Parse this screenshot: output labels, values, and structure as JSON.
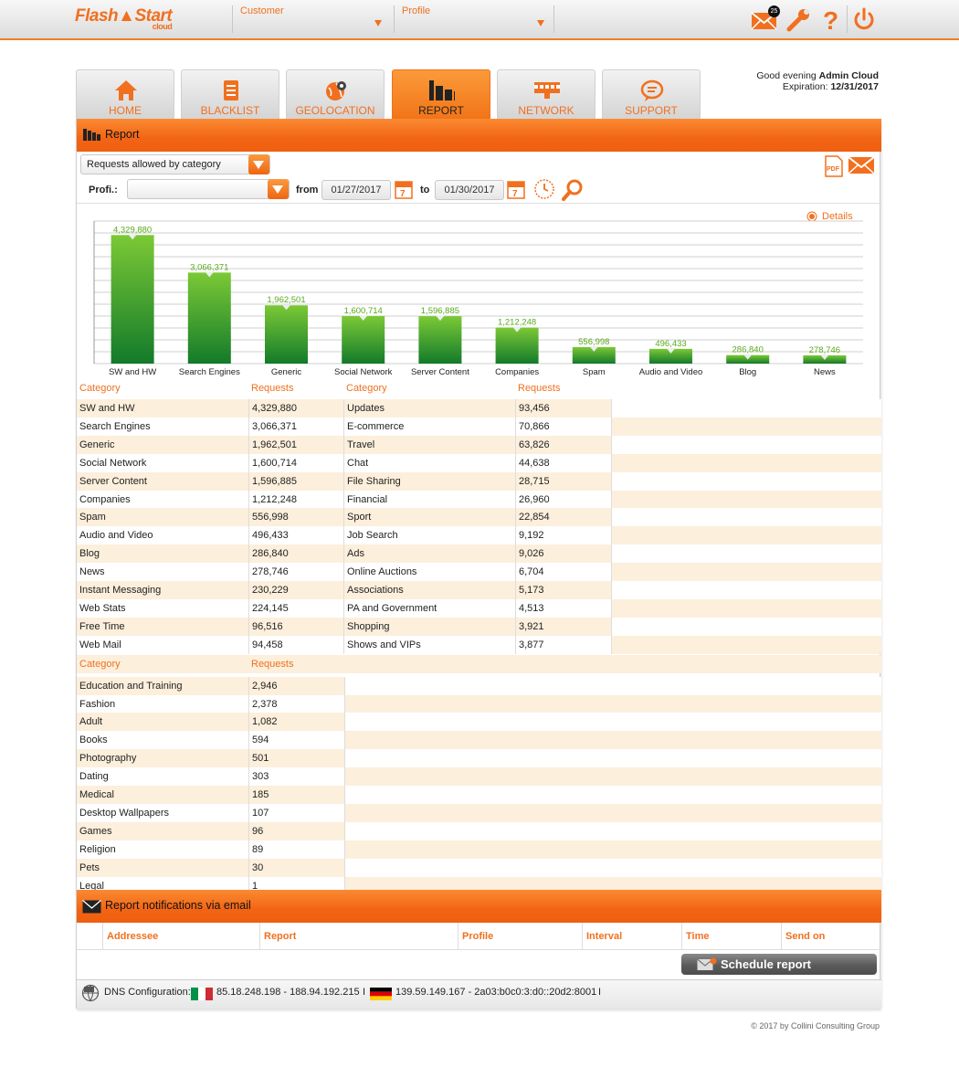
{
  "header": {
    "logo_text": "Flash",
    "logo_text2": "Start",
    "logo_sub": "cloud",
    "customer_label": "Customer",
    "profile_label": "Profile",
    "mail_badge": "25"
  },
  "greeting": {
    "prefix": "Good evening",
    "user": "Admin Cloud",
    "expiration_label": "Expiration:",
    "expiration_value": "12/31/2017"
  },
  "tabs": [
    {
      "label": "HOME",
      "icon": "home-icon"
    },
    {
      "label": "BLACKLIST",
      "icon": "list-icon"
    },
    {
      "label": "GEOLOCATION",
      "icon": "globe-pin-icon"
    },
    {
      "label": "REPORT",
      "icon": "bar-chart-icon",
      "active": true
    },
    {
      "label": "NETWORK",
      "icon": "network-icon"
    },
    {
      "label": "SUPPORT",
      "icon": "chat-bubble-icon"
    }
  ],
  "report": {
    "title": "Report",
    "report_type": "Requests allowed by category",
    "profile_label": "Profi.:",
    "profile_value": "",
    "from_label": "from",
    "from_date": "01/27/2017",
    "to_label": "to",
    "to_date": "01/30/2017",
    "calendar_day": "7",
    "details_label": "Details"
  },
  "chart_data": {
    "type": "bar",
    "categories": [
      "SW and HW",
      "Search Engines",
      "Generic",
      "Social Network",
      "Server Content",
      "Companies",
      "Spam",
      "Audio and Video",
      "Blog",
      "News"
    ],
    "values": [
      4329880,
      3066371,
      1962501,
      1600714,
      1596885,
      1212248,
      556998,
      496433,
      286840,
      278746
    ],
    "value_labels": [
      "4,329,880",
      "3,066,371",
      "1,962,501",
      "1,600,714",
      "1,596,885",
      "1,212,248",
      "556,998",
      "496,433",
      "286,840",
      "278,746"
    ],
    "ylim": [
      0,
      4800000
    ],
    "grid": true,
    "bar_color": "#2e9a2a",
    "label_color": "#5aaa1e"
  },
  "table": {
    "col_category": "Category",
    "col_requests": "Requests",
    "left": [
      [
        "SW and HW",
        "4,329,880"
      ],
      [
        "Search Engines",
        "3,066,371"
      ],
      [
        "Generic",
        "1,962,501"
      ],
      [
        "Social Network",
        "1,600,714"
      ],
      [
        "Server Content",
        "1,596,885"
      ],
      [
        "Companies",
        "1,212,248"
      ],
      [
        "Spam",
        "556,998"
      ],
      [
        "Audio and Video",
        "496,433"
      ],
      [
        "Blog",
        "286,840"
      ],
      [
        "News",
        "278,746"
      ],
      [
        "Instant Messaging",
        "230,229"
      ],
      [
        "Web Stats",
        "224,145"
      ],
      [
        "Free Time",
        "96,516"
      ],
      [
        "Web Mail",
        "94,458"
      ]
    ],
    "right": [
      [
        "Updates",
        "93,456"
      ],
      [
        "E-commerce",
        "70,866"
      ],
      [
        "Travel",
        "63,826"
      ],
      [
        "Chat",
        "44,638"
      ],
      [
        "File Sharing",
        "28,715"
      ],
      [
        "Financial",
        "26,960"
      ],
      [
        "Sport",
        "22,854"
      ],
      [
        "Job Search",
        "9,192"
      ],
      [
        "Ads",
        "9,026"
      ],
      [
        "Online Auctions",
        "6,704"
      ],
      [
        "Associations",
        "5,173"
      ],
      [
        "PA and Government",
        "4,513"
      ],
      [
        "Shopping",
        "3,921"
      ],
      [
        "Shows and VIPs",
        "3,877"
      ]
    ],
    "bottom": [
      [
        "Education and Training",
        "2,946"
      ],
      [
        "Fashion",
        "2,378"
      ],
      [
        "Adult",
        "1,082"
      ],
      [
        "Books",
        "594"
      ],
      [
        "Photography",
        "501"
      ],
      [
        "Dating",
        "303"
      ],
      [
        "Medical",
        "185"
      ],
      [
        "Desktop Wallpapers",
        "107"
      ],
      [
        "Games",
        "96"
      ],
      [
        "Religion",
        "89"
      ],
      [
        "Pets",
        "30"
      ],
      [
        "Legal",
        "1"
      ]
    ]
  },
  "notifications": {
    "title": "Report notifications via email",
    "columns": [
      "Addressee",
      "Report",
      "Profile",
      "Interval",
      "Time",
      "Send on"
    ],
    "schedule_button": "Schedule report"
  },
  "dns": {
    "label": "DNS Configuration:",
    "it_servers": "85.18.248.198 - 188.94.192.215",
    "de_servers": "139.59.149.167 - 2a03:b0c0:3:d0::20d2:8001",
    "sep": "I"
  },
  "footer": {
    "copyright": "© 2017 by Collini Consulting Group"
  },
  "colors": {
    "accent": "#f07020",
    "row_shade": "#fcefdc"
  }
}
